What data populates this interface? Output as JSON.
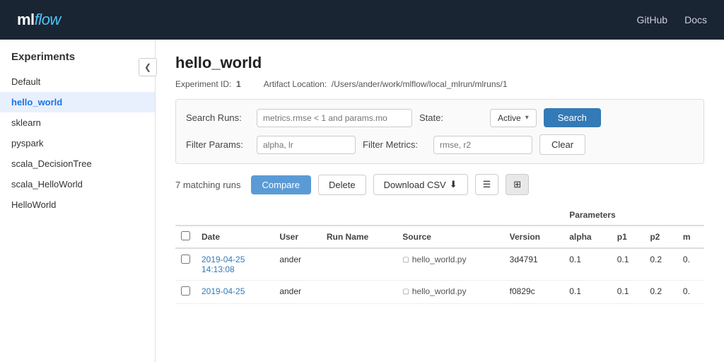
{
  "header": {
    "logo_ml": "ml",
    "logo_flow": "flow",
    "nav": [
      {
        "label": "GitHub",
        "url": "#"
      },
      {
        "label": "Docs",
        "url": "#"
      }
    ]
  },
  "sidebar": {
    "title": "Experiments",
    "collapse_icon": "❮",
    "items": [
      {
        "label": "Default",
        "active": false
      },
      {
        "label": "hello_world",
        "active": true
      },
      {
        "label": "sklearn",
        "active": false
      },
      {
        "label": "pyspark",
        "active": false
      },
      {
        "label": "scala_DecisionTree",
        "active": false
      },
      {
        "label": "scala_HelloWorld",
        "active": false
      },
      {
        "label": "HelloWorld",
        "active": false
      }
    ]
  },
  "main": {
    "page_title": "hello_world",
    "experiment_id_label": "Experiment ID:",
    "experiment_id_value": "1",
    "artifact_location_label": "Artifact Location:",
    "artifact_location_value": "/Users/ander/work/mlflow/local_mlrun/mlruns/1",
    "search": {
      "runs_label": "Search Runs:",
      "runs_placeholder": "metrics.rmse < 1 and params.mo",
      "state_label": "State:",
      "state_value": "Active",
      "state_dropdown_icon": "▾",
      "search_button": "Search",
      "filter_params_label": "Filter Params:",
      "filter_params_placeholder": "alpha, lr",
      "filter_metrics_label": "Filter Metrics:",
      "filter_metrics_placeholder": "rmse, r2",
      "clear_button": "Clear"
    },
    "toolbar": {
      "run_count": "7 matching runs",
      "compare_button": "Compare",
      "delete_button": "Delete",
      "download_button": "Download CSV",
      "download_icon": "⬇",
      "list_view_icon": "☰",
      "grid_view_icon": "⊞"
    },
    "table": {
      "params_group_label": "Parameters",
      "columns": [
        "",
        "Date",
        "User",
        "Run Name",
        "Source",
        "Version",
        "alpha",
        "p1",
        "p2",
        "m"
      ],
      "rows": [
        {
          "checked": false,
          "date_line1": "2019-04-25",
          "date_line2": "14:13:08",
          "user": "ander",
          "run_name": "",
          "source": "hello_world.py",
          "version": "3d4791",
          "alpha": "0.1",
          "p1": "0.1",
          "p2": "0.2",
          "m": "0."
        },
        {
          "checked": false,
          "date_line1": "2019-04-25",
          "date_line2": "",
          "user": "ander",
          "run_name": "",
          "source": "hello_world.py",
          "version": "f0829c",
          "alpha": "0.1",
          "p1": "0.1",
          "p2": "0.2",
          "m": "0."
        }
      ]
    }
  }
}
